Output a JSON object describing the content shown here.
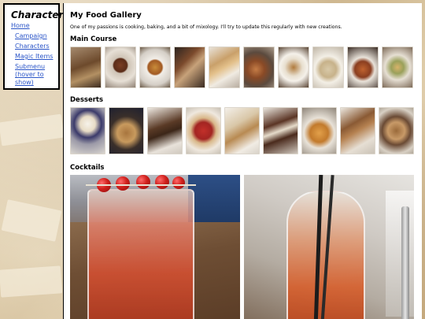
{
  "sidebar": {
    "title": "Characters",
    "links": {
      "home": "Home",
      "campaign": "Campaign",
      "characters": "Characters",
      "magic_items": "Magic Items",
      "submenu": "Submenu (hover to show)"
    }
  },
  "main": {
    "title": "My Food Gallery",
    "intro": "One of my passions is cooking, baking, and a bit of mixology. I'll try to update this regularly with new creations.",
    "sections": {
      "main_course": "Main Course",
      "desserts": "Desserts",
      "cocktails": "Cocktails"
    }
  },
  "colors": {
    "link": "#2a55c8",
    "panel_background": "#ffffff",
    "page_background": "#d6c19d"
  }
}
